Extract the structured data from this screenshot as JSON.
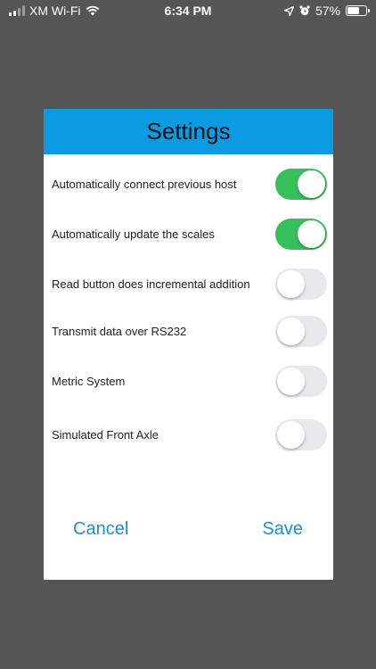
{
  "status_bar": {
    "carrier": "XM Wi-Fi",
    "time": "6:34 PM",
    "battery_percent": "57%",
    "battery_level": 0.57
  },
  "dialog": {
    "title": "Settings",
    "settings": [
      {
        "label": "Automatically connect previous host",
        "on": true
      },
      {
        "label": "Automatically update the scales",
        "on": true
      },
      {
        "label": "Read button does incremental addition",
        "on": false
      },
      {
        "label": "Transmit data over RS232",
        "on": false
      },
      {
        "label": "Metric System",
        "on": false
      },
      {
        "label": "Simulated Front Axle",
        "on": false
      }
    ],
    "cancel_label": "Cancel",
    "save_label": "Save"
  },
  "colors": {
    "header": "#0a9be3",
    "toggle_on": "#36c05a",
    "toggle_off": "#e9e9eb",
    "action": "#1e8fd6",
    "overlay": "#555555"
  }
}
